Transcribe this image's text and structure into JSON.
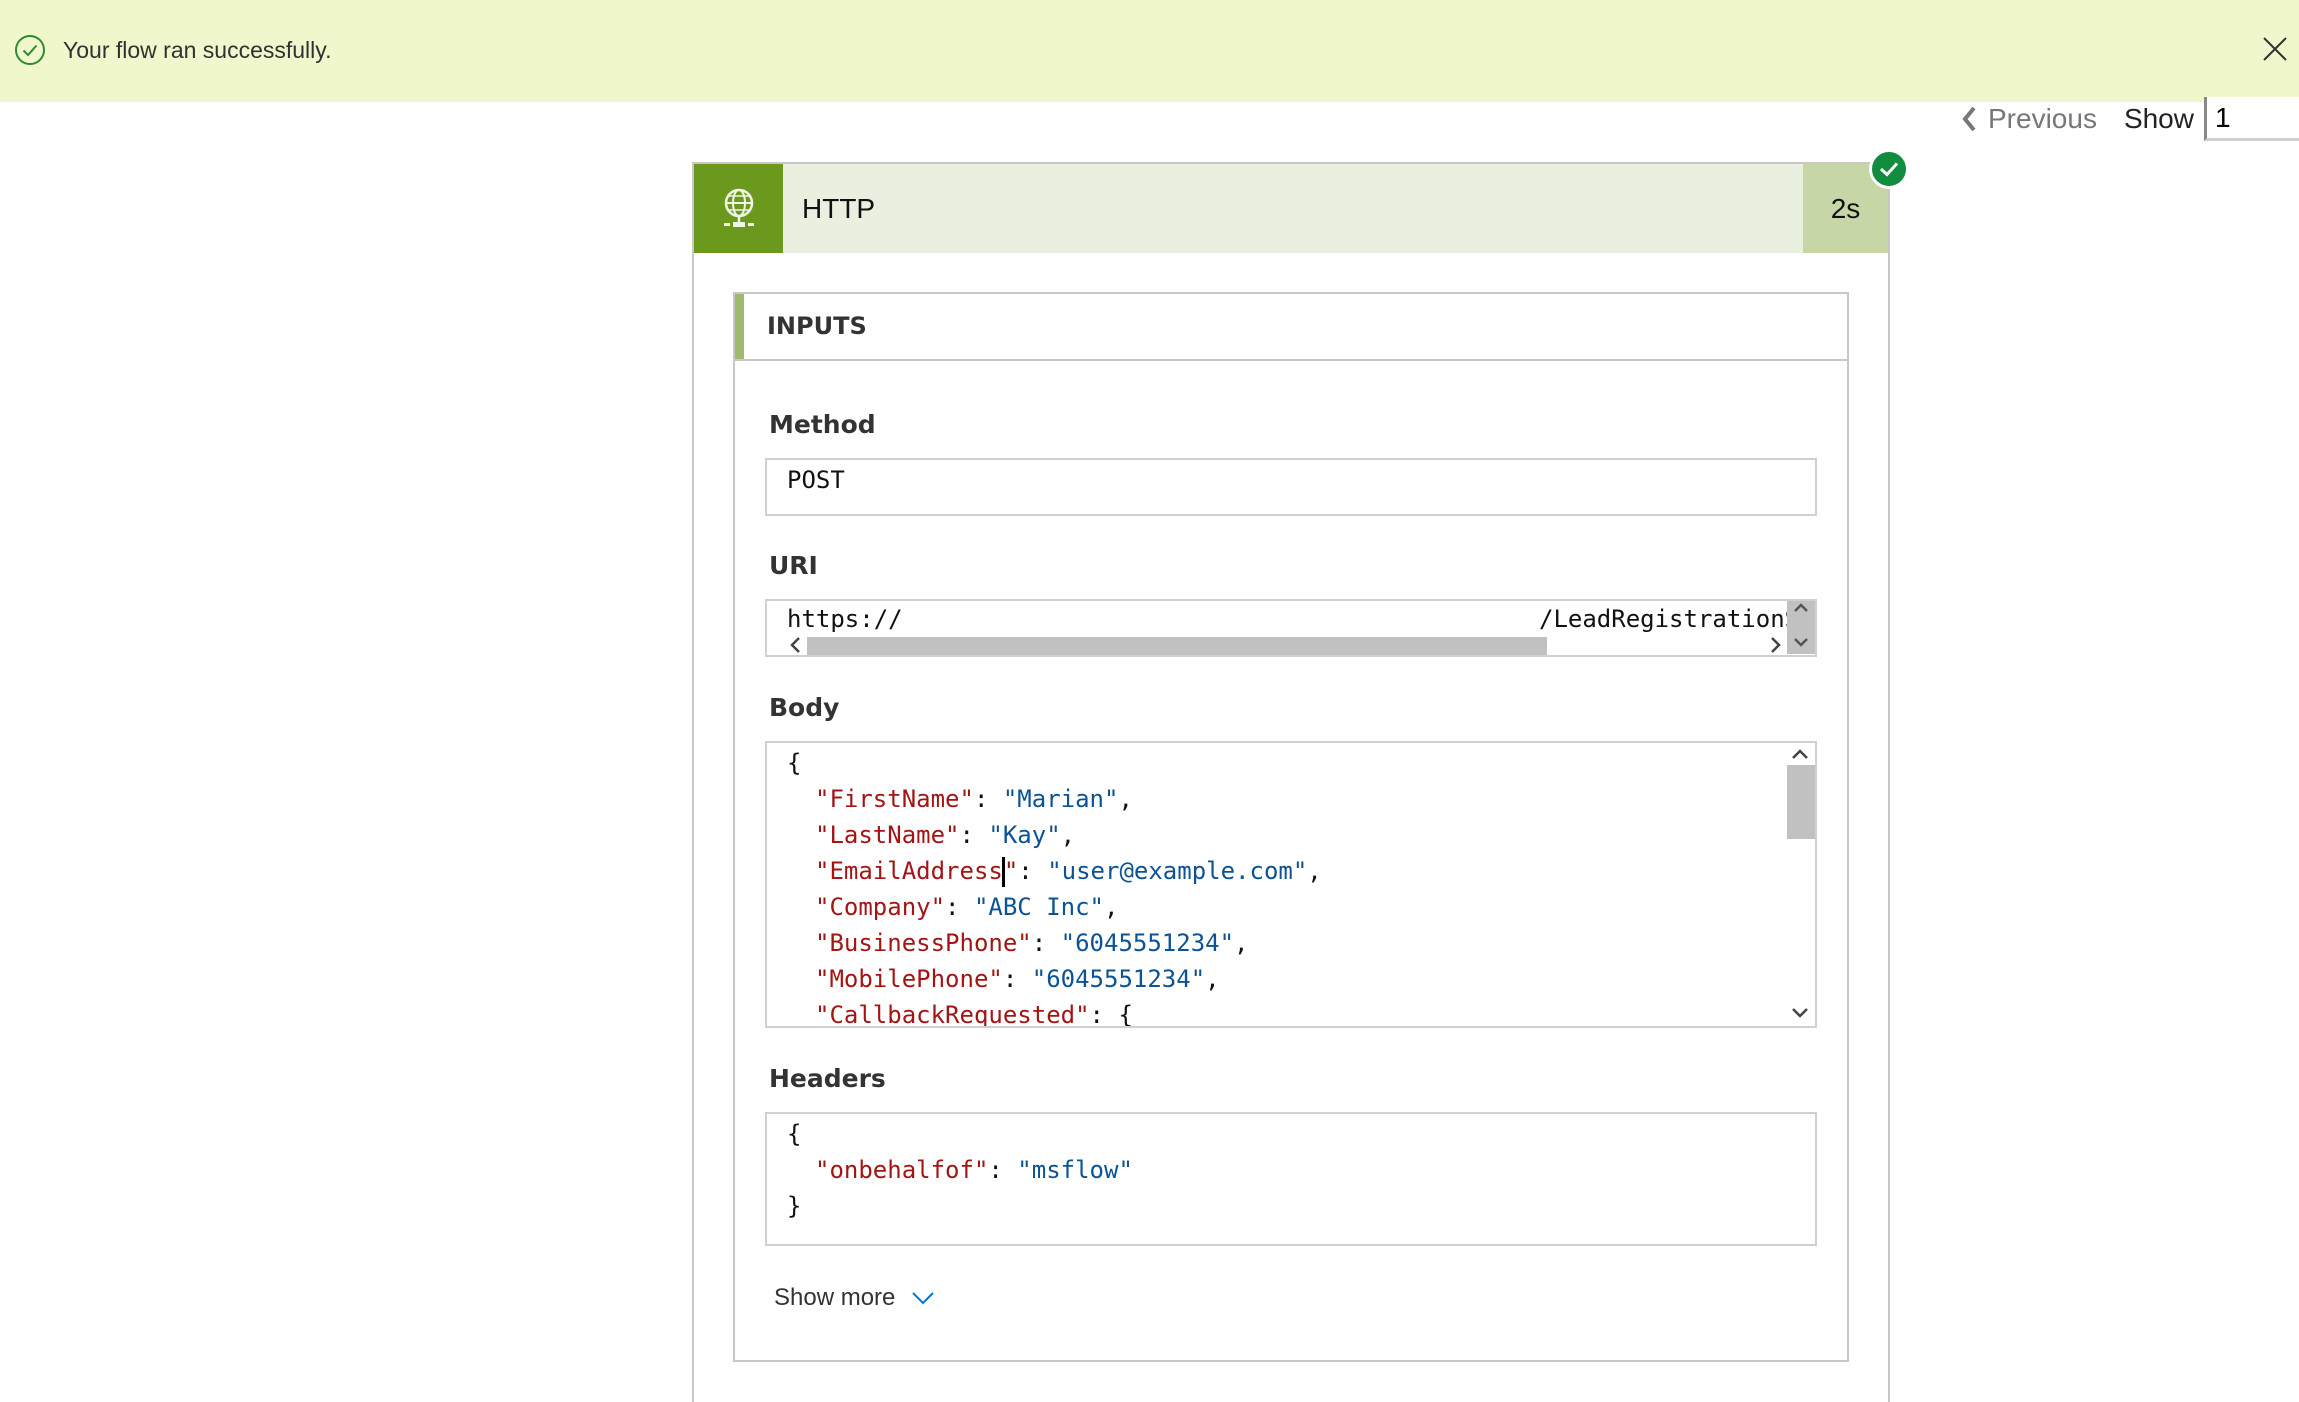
{
  "banner": {
    "message": "Your flow ran successfully.",
    "icon": "success-check-circle-icon",
    "close_icon": "close-icon"
  },
  "pager": {
    "previous_label": "Previous",
    "show_label": "Show",
    "value": "1"
  },
  "action": {
    "title": "HTTP",
    "icon": "globe-network-icon",
    "duration": "2s",
    "status": "succeeded"
  },
  "inputs": {
    "section_title": "INPUTS",
    "method": {
      "label": "Method",
      "value": "POST"
    },
    "uri": {
      "label": "URI",
      "value_start": "https://",
      "value_end": "/LeadRegistrationSar"
    },
    "body": {
      "label": "Body",
      "open_brace": "{",
      "lines": [
        {
          "key": "\"FirstName\"",
          "sep": ": ",
          "value": "\"Marian\"",
          "tail": ","
        },
        {
          "key": "\"LastName\"",
          "sep": ": ",
          "value": "\"Kay\"",
          "tail": ","
        },
        {
          "key": "\"EmailAddress\"",
          "sep": ": ",
          "value": "\"user@example.com\"",
          "tail": ","
        },
        {
          "key": "\"Company\"",
          "sep": ": ",
          "value": "\"ABC Inc\"",
          "tail": ","
        },
        {
          "key": "\"BusinessPhone\"",
          "sep": ": ",
          "value": "\"6045551234\"",
          "tail": ","
        },
        {
          "key": "\"MobilePhone\"",
          "sep": ": ",
          "value": "\"6045551234\"",
          "tail": ","
        },
        {
          "key": "\"CallbackRequested\"",
          "sep": ": ",
          "value": "",
          "tail": "{"
        }
      ]
    },
    "headers": {
      "label": "Headers",
      "open_brace": "{",
      "close_brace": "}",
      "lines": [
        {
          "key": "\"onbehalfof\"",
          "sep": ": ",
          "value": "\"msflow\"",
          "tail": ""
        }
      ]
    },
    "show_more_label": "Show more"
  },
  "colors": {
    "banner_bg": "#f0f7cd",
    "success_green": "#128c3e",
    "action_icon_bg": "#6a991e",
    "action_header_bg": "#e9f0df",
    "duration_bg": "#c7d6a7",
    "json_key": "#a31515",
    "json_value": "#0b5394",
    "link_blue": "#0078d4"
  }
}
